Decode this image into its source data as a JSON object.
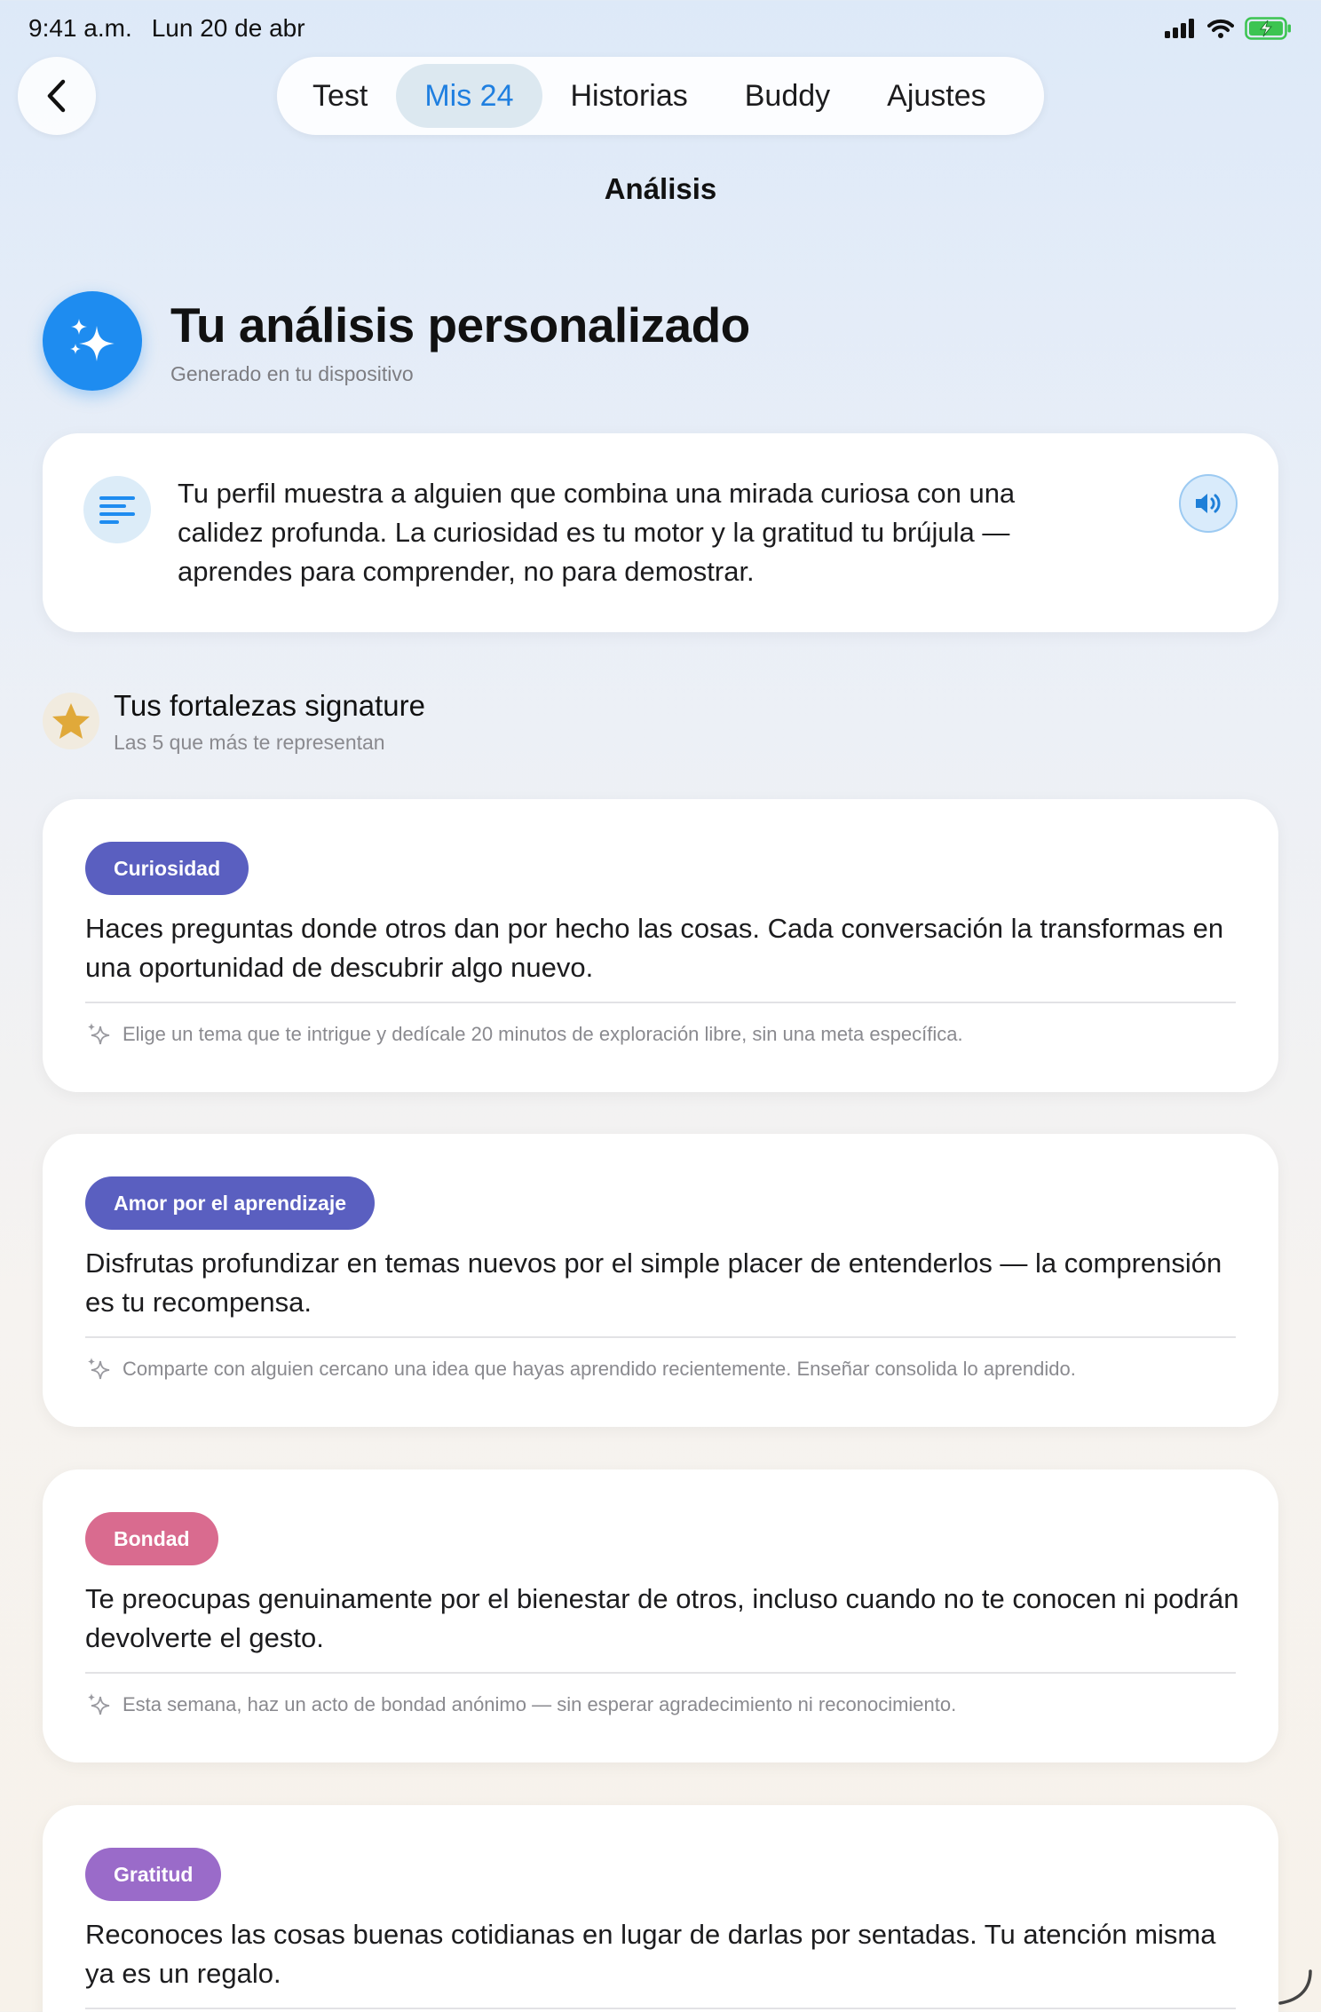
{
  "status": {
    "time": "9:41 a.m.",
    "date": "Lun 20 de abr"
  },
  "nav": {
    "tabs": [
      {
        "label": "Test"
      },
      {
        "label": "Mis 24"
      },
      {
        "label": "Historias"
      },
      {
        "label": "Buddy"
      },
      {
        "label": "Ajustes"
      }
    ],
    "active_tab": "Mis 24",
    "page_title": "Análisis"
  },
  "hero": {
    "title": "Tu análisis personalizado",
    "subtitle": "Generado en tu dispositivo",
    "icon": "sparkles-icon"
  },
  "summary": {
    "text": "Tu perfil muestra a alguien que combina una mirada curiosa con una calidez profunda. La curiosidad es tu motor y la gratitud tu brújula — aprendes para comprender, no para demostrar.",
    "icon": "text-lines-icon",
    "action_icon": "speaker-icon"
  },
  "strengths": {
    "title": "Tus fortalezas signature",
    "subtitle": "Las 5 que más te representan",
    "icon": "star-icon",
    "items": [
      {
        "badge": "Curiosidad",
        "color": "#5a5fc0",
        "description": "Haces preguntas donde otros dan por hecho las cosas. Cada conversación la transformas en una oportunidad de descubrir algo nuevo.",
        "tip": "Elige un tema que te intrigue y dedícale 20 minutos de exploración libre, sin una meta específica."
      },
      {
        "badge": "Amor por el aprendizaje",
        "color": "#5a5fc0",
        "description": "Disfrutas profundizar en temas nuevos por el simple placer de entenderlos — la comprensión es tu recompensa.",
        "tip": "Comparte con alguien cercano una idea que hayas aprendido recientemente. Enseñar consolida lo aprendido."
      },
      {
        "badge": "Bondad",
        "color": "#d96b8f",
        "description": "Te preocupas genuinamente por el bienestar de otros, incluso cuando no te conocen ni podrán devolverte el gesto.",
        "tip": "Esta semana, haz un acto de bondad anónimo — sin esperar agradecimiento ni reconocimiento."
      },
      {
        "badge": "Gratitud",
        "color": "#9a6bc9",
        "description": "Reconoces las cosas buenas cotidianas en lugar de darlas por sentadas. Tu atención misma ya es un regalo.",
        "tip": ""
      }
    ]
  }
}
